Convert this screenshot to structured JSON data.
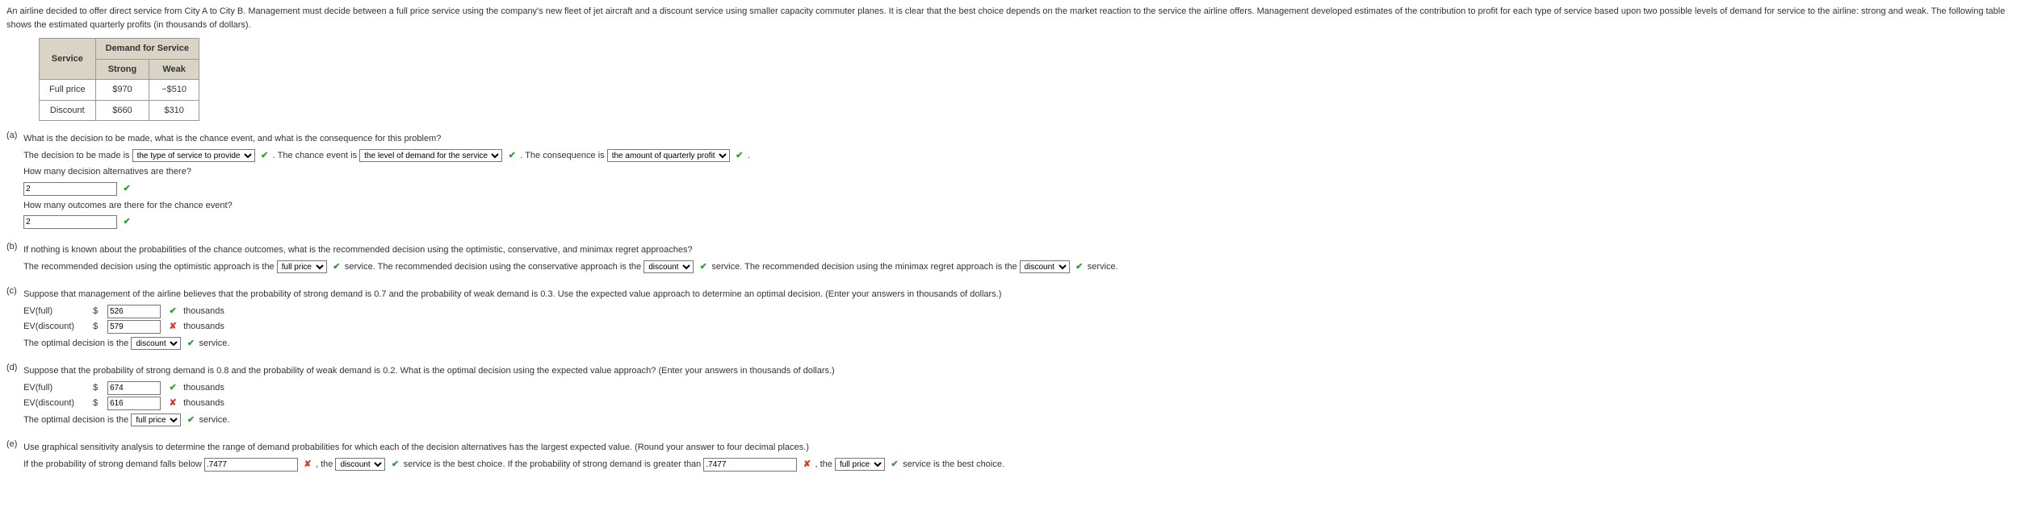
{
  "intro": "An airline decided to offer direct service from City A to City B. Management must decide between a full price service using the company's new fleet of jet aircraft and a discount service using smaller capacity commuter planes. It is clear that the best choice depends on the market reaction to the service the airline offers. Management developed estimates of the contribution to profit for each type of service based upon two possible levels of demand for service to the airline: strong and weak. The following table shows the estimated quarterly profits (in thousands of dollars).",
  "table": {
    "h_service": "Service",
    "h_demand": "Demand for Service",
    "h_strong": "Strong",
    "h_weak": "Weak",
    "r1_label": "Full price",
    "r1_strong": "$970",
    "r1_weak": "−$510",
    "r2_label": "Discount",
    "r2_strong": "$660",
    "r2_weak": "$310"
  },
  "a": {
    "label": "(a)",
    "q1": "What is the decision to be made, what is the chance event, and what is the consequence for this problem?",
    "decision_pre": "The decision to be made is",
    "decision_val": "the type of service to provide",
    "chance_pre": ". The chance event is",
    "chance_val": "the level of demand for the service",
    "conseq_pre": ". The consequence is",
    "conseq_val": "the amount of quarterly profit",
    "period": ".",
    "q2": "How many decision alternatives are there?",
    "q2_val": "2",
    "q3": "How many outcomes are there for the chance event?",
    "q3_val": "2"
  },
  "b": {
    "label": "(b)",
    "q": "If nothing is known about the probabilities of the chance outcomes, what is the recommended decision using the optimistic, conservative, and minimax regret approaches?",
    "opt_pre": "The recommended decision using the optimistic approach is the",
    "opt_val": "full price",
    "cons_pre": "service. The recommended decision using the conservative approach is the",
    "cons_val": "discount",
    "mm_pre": "service. The recommended decision using the minimax regret approach is the",
    "mm_val": "discount",
    "tail": "service."
  },
  "c": {
    "label": "(c)",
    "q": "Suppose that management of the airline believes that the probability of strong demand is 0.7 and the probability of weak demand is 0.3. Use the expected value approach to determine an optimal decision. (Enter your answers in thousands of dollars.)",
    "ev_full_label": "EV(full)",
    "ev_full_val": "526",
    "ev_disc_label": "EV(discount)",
    "ev_disc_val": "579",
    "thousands": "thousands",
    "dollar": "$",
    "opt_pre": "The optimal decision is the",
    "opt_val": "discount",
    "opt_tail": "service."
  },
  "d": {
    "label": "(d)",
    "q": "Suppose that the probability of strong demand is 0.8 and the probability of weak demand is 0.2. What is the optimal decision using the expected value approach? (Enter your answers in thousands of dollars.)",
    "ev_full_val": "674",
    "ev_disc_val": "616",
    "opt_val": "full price"
  },
  "e": {
    "label": "(e)",
    "q": "Use graphical sensitivity analysis to determine the range of demand probabilities for which each of the decision alternatives has the largest expected value. (Round your answer to four decimal places.)",
    "below_pre": "If the probability of strong demand falls below",
    "below_val": ".7477",
    "below_mid": ", the",
    "below_choice": "discount",
    "above_pre": "service is the best choice. If the probability of strong demand is greater than",
    "above_val": ".7477",
    "above_mid": ", the",
    "above_choice": "full price",
    "tail": "service is the best choice."
  },
  "marks": {
    "ok": "✔",
    "bad": "✘"
  }
}
